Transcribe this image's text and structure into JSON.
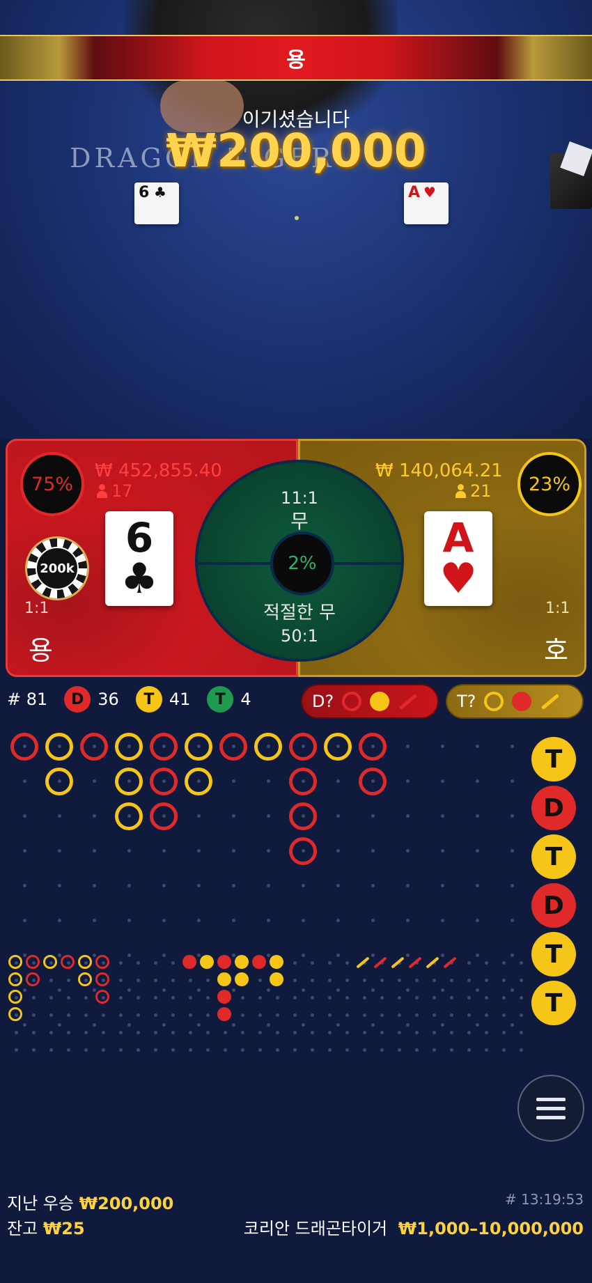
{
  "banner": {
    "result": "용"
  },
  "win": {
    "message": "이기셨습니다",
    "amount": "₩200,000",
    "table_logo": "DRAGON TIGER"
  },
  "table_cards": {
    "dragon": {
      "value": "6",
      "suit": "♣"
    },
    "tiger": {
      "value": "A",
      "suit": "♥"
    }
  },
  "dragon": {
    "percent": "75%",
    "bet_total": "₩ 452,855.40",
    "players": "17",
    "card_value": "6",
    "card_suit": "♣",
    "chip": "200k",
    "payout": "1:1",
    "label": "용"
  },
  "tiger": {
    "percent": "23%",
    "bet_total": "₩ 140,064.21",
    "players": "21",
    "card_value": "A",
    "card_suit": "♥",
    "payout": "1:1",
    "label": "호"
  },
  "tie": {
    "payout": "11:1",
    "label": "무",
    "percent": "2%",
    "suited_label": "적절한 무",
    "suited_payout": "50:1"
  },
  "stats": {
    "rounds": "# 81",
    "dragon_badge": "D",
    "dragon_count": "36",
    "tiger_badge": "T",
    "tiger_count": "41",
    "tie_badge": "T",
    "tie_count": "4"
  },
  "predictions": {
    "dragon": "D?",
    "tiger": "T?"
  },
  "side_results": [
    "T",
    "D",
    "T",
    "D",
    "T",
    "T"
  ],
  "footer": {
    "last_win_label": "지난 우승",
    "last_win_value": "₩200,000",
    "balance_label": "잔고",
    "balance_value": "₩25",
    "round_id": "# 13:19:53",
    "table_name": "코리안 드래곤타이거",
    "limits": "₩1,000–10,000,000"
  },
  "colors": {
    "dragon": "#e02a2a",
    "tiger": "#f5c518",
    "tie": "#1f9a4e"
  },
  "icons": [
    "person-icon",
    "menu-icon"
  ]
}
